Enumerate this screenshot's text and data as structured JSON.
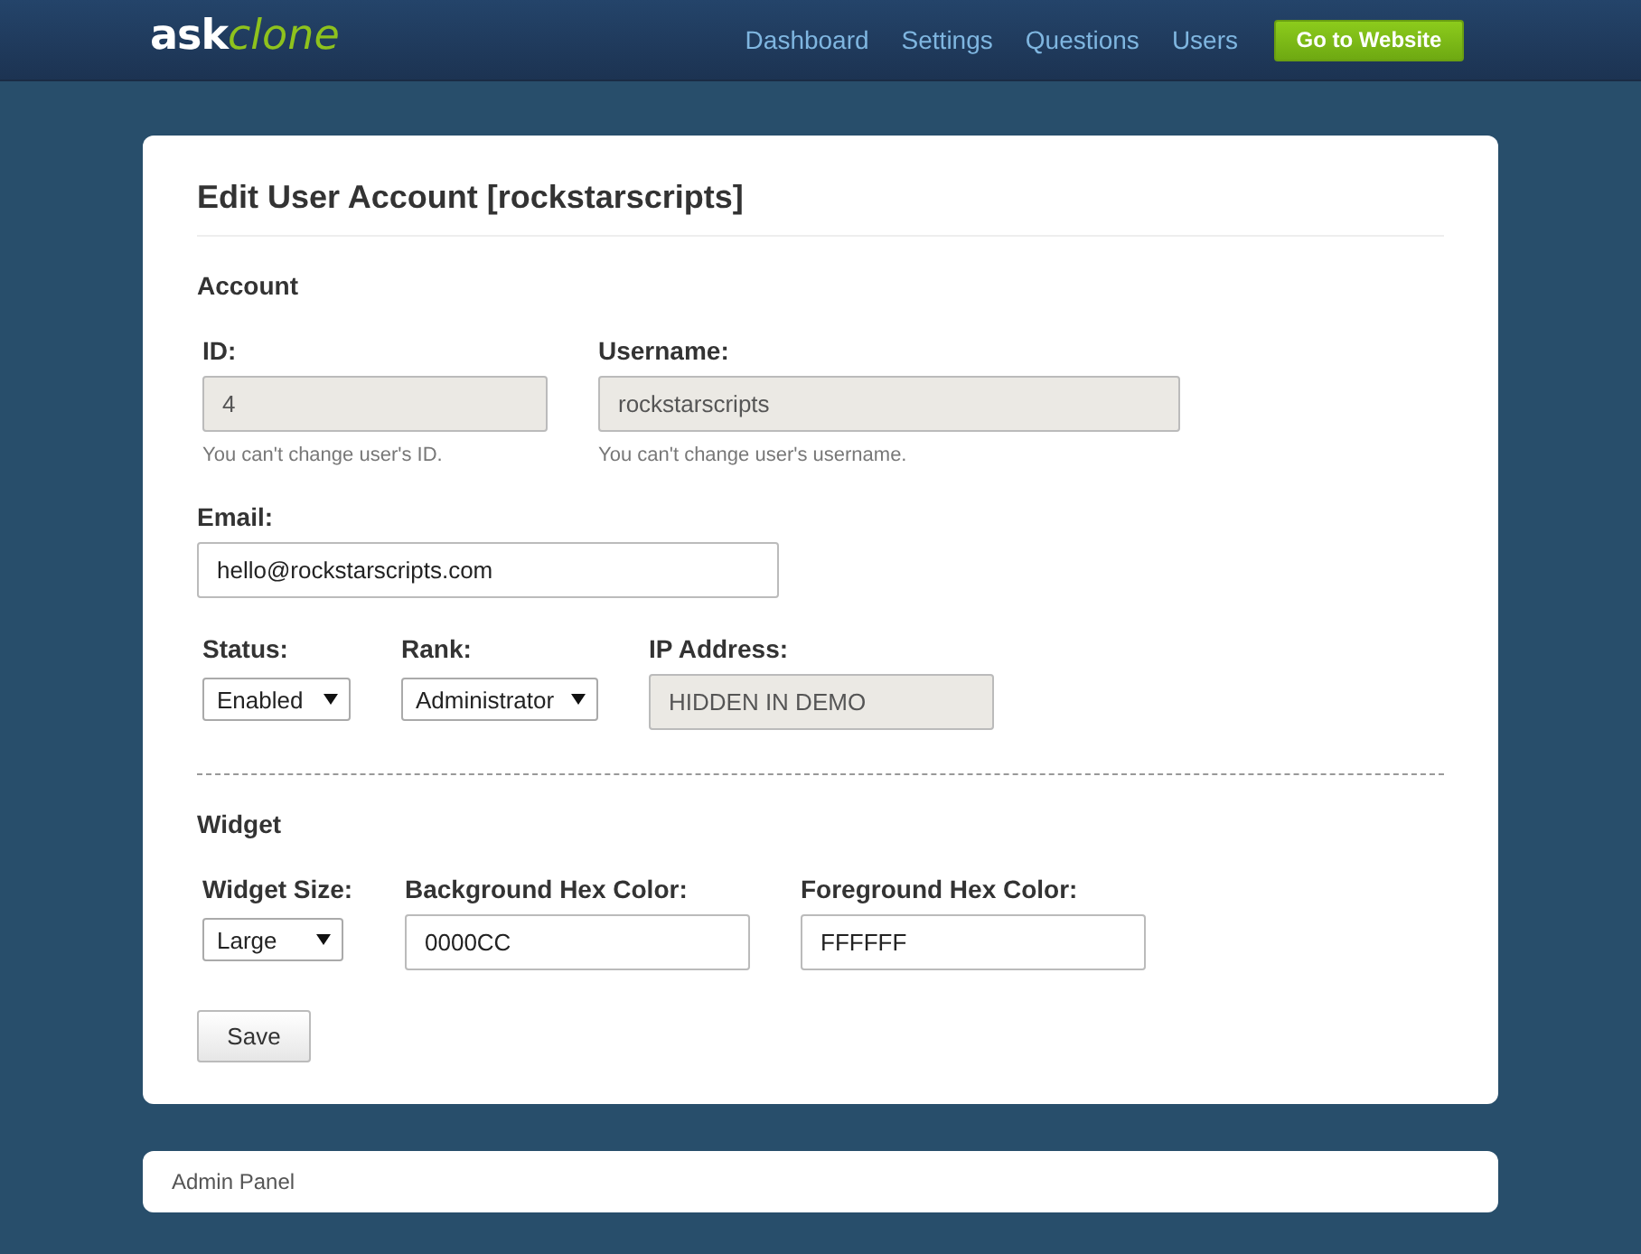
{
  "header": {
    "logo": {
      "bold": "ask",
      "light": "clone"
    },
    "nav": [
      {
        "label": "Dashboard"
      },
      {
        "label": "Settings"
      },
      {
        "label": "Questions"
      },
      {
        "label": "Users"
      }
    ],
    "website_button": "Go to Website"
  },
  "form": {
    "title": "Edit User Account [rockstarscripts]",
    "sections": [
      {
        "heading": "Account",
        "groups": [
          {
            "fields": [
              {
                "label": "ID:",
                "kind": "text",
                "value": "4",
                "disabled": true,
                "help": "You can't change user's ID."
              },
              {
                "label": "Username:",
                "kind": "text",
                "value": "rockstarscripts",
                "disabled": true,
                "help": "You can't change user's username."
              }
            ]
          },
          {
            "fields": [
              {
                "label": "Email:",
                "kind": "text",
                "value": "hello@rockstarscripts.com",
                "disabled": false
              }
            ]
          },
          {
            "fields": [
              {
                "label": "Status:",
                "kind": "select",
                "value": "Enabled",
                "disabled": false
              },
              {
                "label": "Rank:",
                "kind": "select",
                "value": "Administrator",
                "disabled": false
              },
              {
                "label": "IP Address:",
                "kind": "text",
                "value": "HIDDEN IN DEMO",
                "disabled": true
              }
            ]
          }
        ]
      },
      {
        "heading": "Widget",
        "groups": [
          {
            "fields": [
              {
                "label": "Widget Size:",
                "kind": "select",
                "value": "Large",
                "disabled": false
              },
              {
                "label": "Background Hex Color:",
                "kind": "text",
                "value": "0000CC",
                "disabled": false
              },
              {
                "label": "Foreground Hex Color:",
                "kind": "text",
                "value": "FFFFFF",
                "disabled": false
              }
            ]
          }
        ]
      }
    ],
    "save_button": "Save"
  },
  "footer": "Admin Panel"
}
